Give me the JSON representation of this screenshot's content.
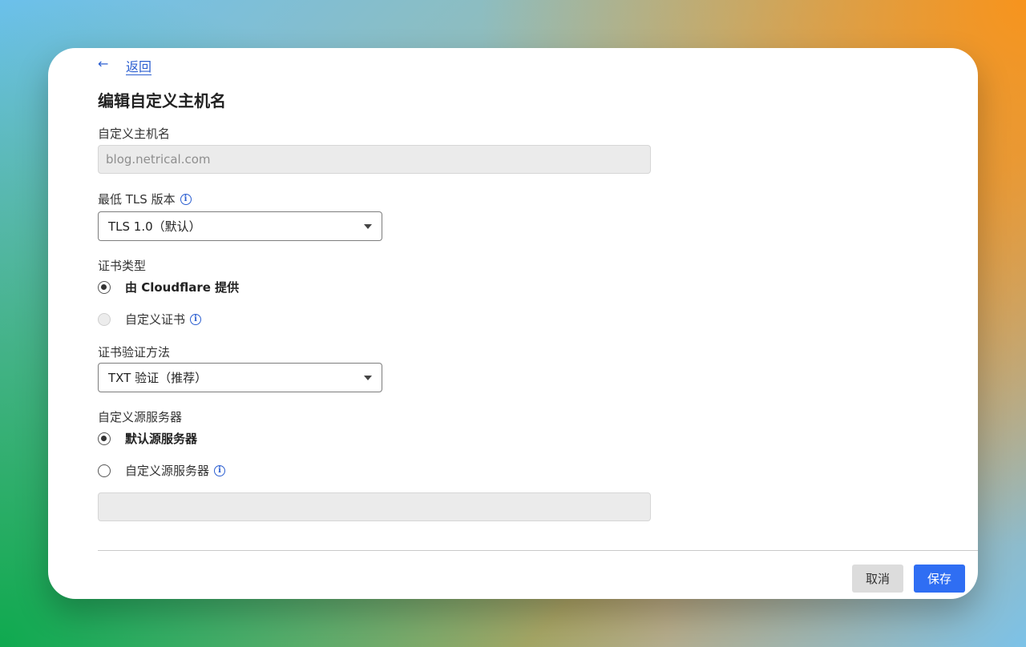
{
  "nav": {
    "back_label": "返回",
    "back_arrow": "←"
  },
  "page": {
    "title": "编辑自定义主机名"
  },
  "fields": {
    "hostname": {
      "label": "自定义主机名",
      "value": "blog.netrical.com"
    },
    "min_tls": {
      "label": "最低 TLS 版本",
      "selected": "TLS 1.0（默认）"
    },
    "cert_type": {
      "label": "证书类型",
      "options": [
        {
          "label": "由 Cloudflare 提供",
          "checked": true
        },
        {
          "label": "自定义证书",
          "checked": false,
          "disabled": true
        }
      ]
    },
    "cert_validation": {
      "label": "证书验证方法",
      "selected": "TXT 验证（推荐）"
    },
    "origin_server": {
      "label": "自定义源服务器",
      "options": [
        {
          "label": "默认源服务器",
          "checked": true
        },
        {
          "label": "自定义源服务器",
          "checked": false
        }
      ],
      "custom_value": ""
    }
  },
  "actions": {
    "cancel_label": "取消",
    "save_label": "保存"
  },
  "icons": {
    "info": "i"
  },
  "colors": {
    "accent": "#2f6ef3",
    "link": "#2c5fd1",
    "disabled_bg": "#ebebeb"
  }
}
